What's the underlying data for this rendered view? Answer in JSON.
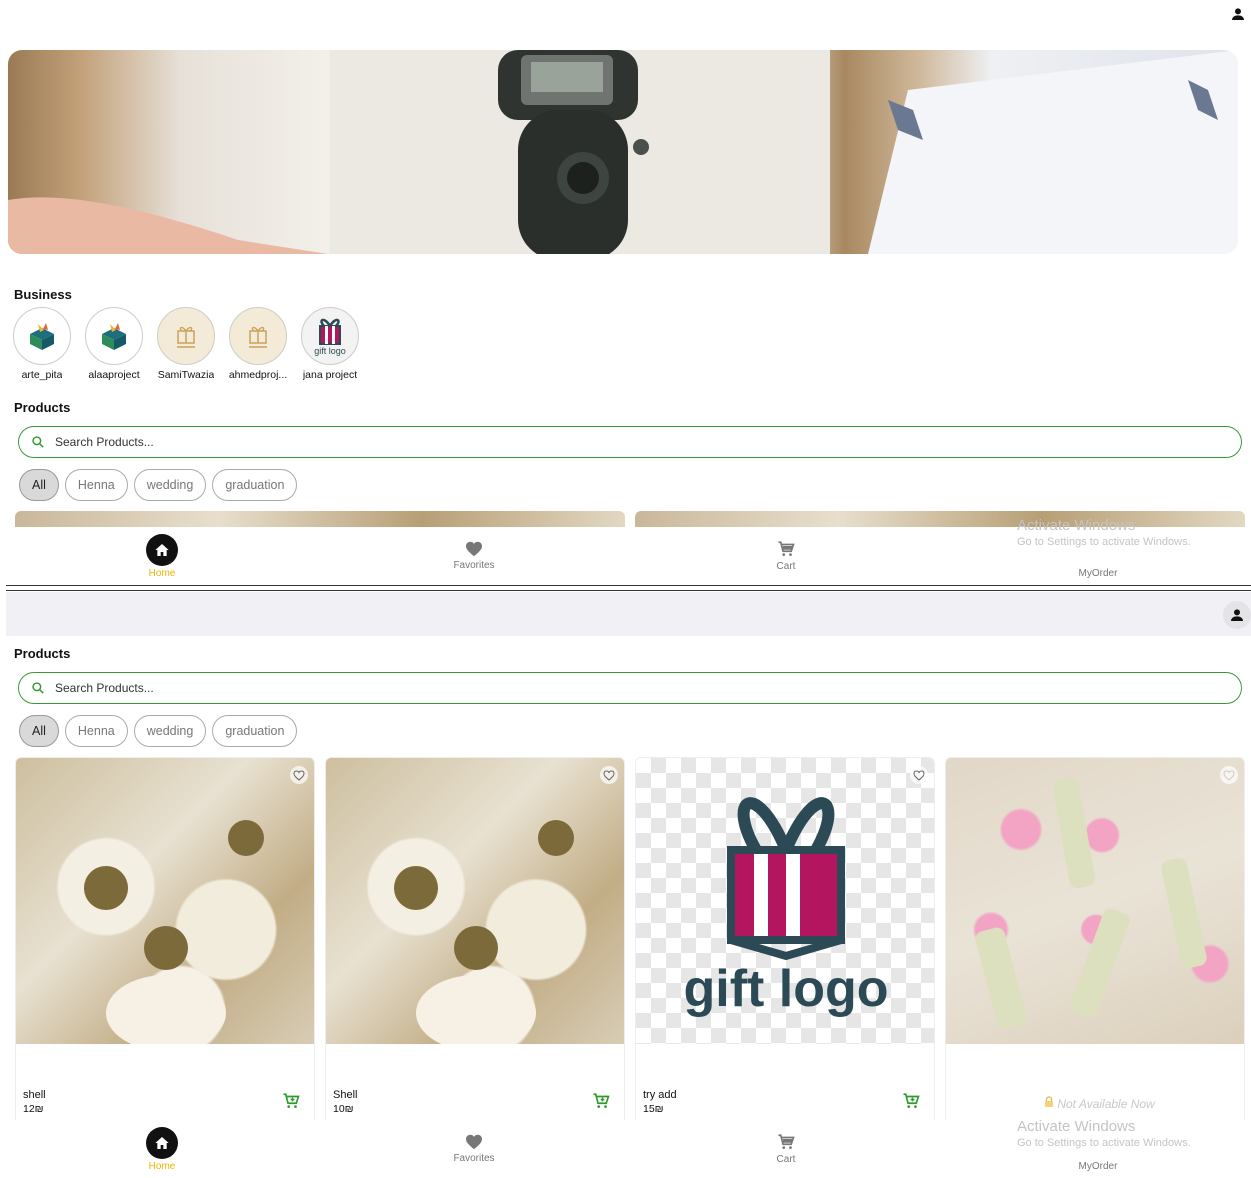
{
  "header": {
    "profile_icon": "person-icon"
  },
  "business": {
    "title": "Business",
    "items": [
      {
        "name": "arte_pita"
      },
      {
        "name": "alaaproject"
      },
      {
        "name": "SamiTwazia"
      },
      {
        "name": "ahmedproj..."
      },
      {
        "name": "jana project",
        "logo_text": "gift logo"
      }
    ]
  },
  "products": {
    "title": "Products",
    "search_placeholder": "Search Products...",
    "filters": [
      "All",
      "Henna",
      "wedding",
      "graduation"
    ],
    "active_filter": "All",
    "items": [
      {
        "name": "shell",
        "price": "12₪",
        "image": "shell"
      },
      {
        "name": "Shell",
        "price": "10₪",
        "image": "shell"
      },
      {
        "name": "try add",
        "price": "15₪",
        "image": "gift"
      },
      {
        "name": "",
        "price": "",
        "image": "bottles",
        "unavailable_text": "Not Available Now"
      }
    ],
    "gift_logo_text": "gift logo"
  },
  "nav": {
    "items": [
      {
        "label": "Home",
        "icon": "home-icon",
        "active": true
      },
      {
        "label": "Favorites",
        "icon": "heart-icon"
      },
      {
        "label": "Cart",
        "icon": "cart-icon"
      },
      {
        "label": "MyOrder",
        "icon": "order-icon"
      }
    ],
    "active_color": "#f0b400"
  },
  "watermark": {
    "title": "Activate Windows",
    "sub": "Go to Settings to activate Windows."
  },
  "colors": {
    "accent": "#3a9a3a",
    "cart_icon": "#2f9a2f"
  }
}
